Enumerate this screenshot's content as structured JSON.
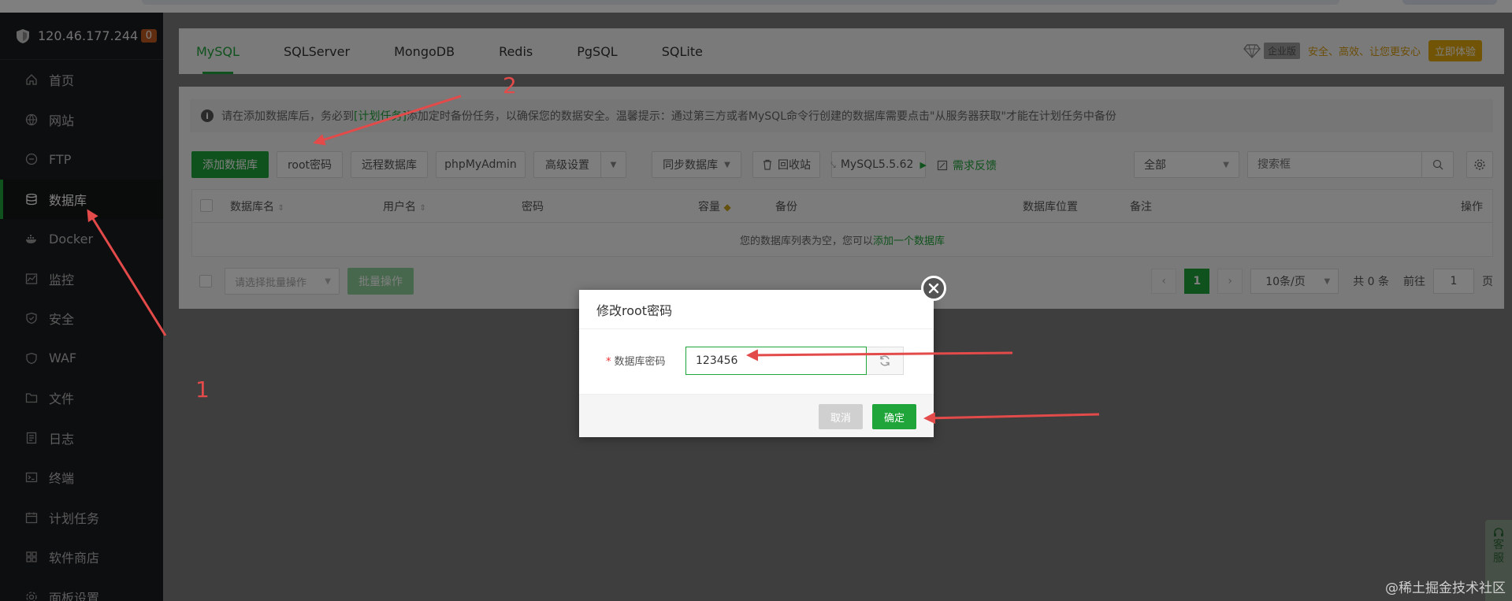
{
  "server": {
    "ip": "120.46.177.244",
    "badge": "0"
  },
  "sidebar": {
    "items": [
      {
        "label": "首页",
        "icon": "home-icon"
      },
      {
        "label": "网站",
        "icon": "globe-icon"
      },
      {
        "label": "FTP",
        "icon": "ftp-icon"
      },
      {
        "label": "数据库",
        "icon": "database-icon",
        "active": true
      },
      {
        "label": "Docker",
        "icon": "docker-icon"
      },
      {
        "label": "监控",
        "icon": "monitor-icon"
      },
      {
        "label": "安全",
        "icon": "shield-icon"
      },
      {
        "label": "WAF",
        "icon": "waf-icon"
      },
      {
        "label": "文件",
        "icon": "folder-icon"
      },
      {
        "label": "日志",
        "icon": "log-icon"
      },
      {
        "label": "终端",
        "icon": "terminal-icon"
      },
      {
        "label": "计划任务",
        "icon": "calendar-icon"
      },
      {
        "label": "软件商店",
        "icon": "store-icon"
      },
      {
        "label": "面板设置",
        "icon": "settings-icon"
      }
    ]
  },
  "tabs": [
    "MySQL",
    "SQLServer",
    "MongoDB",
    "Redis",
    "PgSQL",
    "SQLite"
  ],
  "promo": {
    "edition": "企业版",
    "slogan": "安全、高效、让您更安心",
    "try": "立即体验"
  },
  "notice": {
    "prefix": "请在添加数据库后，务必到",
    "link": "[计划任务]",
    "suffix": "添加定时备份任务，以确保您的数据安全。温馨提示：通过第三方或者MySQL命令行创建的数据库需要点击\"从服务器获取\"才能在计划任务中备份"
  },
  "toolbar": {
    "add": "添加数据库",
    "root": "root密码",
    "remote": "远程数据库",
    "pma": "phpMyAdmin",
    "advanced": "高级设置",
    "sync": "同步数据库",
    "recycle": "回收站",
    "version": "MySQL5.5.62",
    "feedback": "需求反馈",
    "filter": "全部",
    "search_placeholder": "搜索框"
  },
  "table": {
    "columns": [
      "数据库名",
      "用户名",
      "密码",
      "容量",
      "备份",
      "数据库位置",
      "备注",
      "操作"
    ],
    "empty_prefix": "您的数据库列表为空，您可以",
    "empty_link": "添加一个数据库"
  },
  "footer": {
    "batch_placeholder": "请选择批量操作",
    "batch_button": "批量操作",
    "current_page": "1",
    "page_size": "10条/页",
    "total": "共 0 条",
    "goto_label": "前往",
    "goto_value": "1",
    "page_suffix": "页"
  },
  "modal": {
    "title": "修改root密码",
    "required_mark": "*",
    "field_label": "数据库密码",
    "password": "123456",
    "cancel": "取消",
    "ok": "确定"
  },
  "annotations": {
    "one": "1",
    "two": "2"
  },
  "service": {
    "chars": [
      "客",
      "服"
    ]
  },
  "watermark": "@稀土掘金技术社区",
  "colors": {
    "accent": "#20a53a",
    "sidebar": "#1a1c1e",
    "arrow": "#e34a4a",
    "gold": "#e4a80d"
  }
}
